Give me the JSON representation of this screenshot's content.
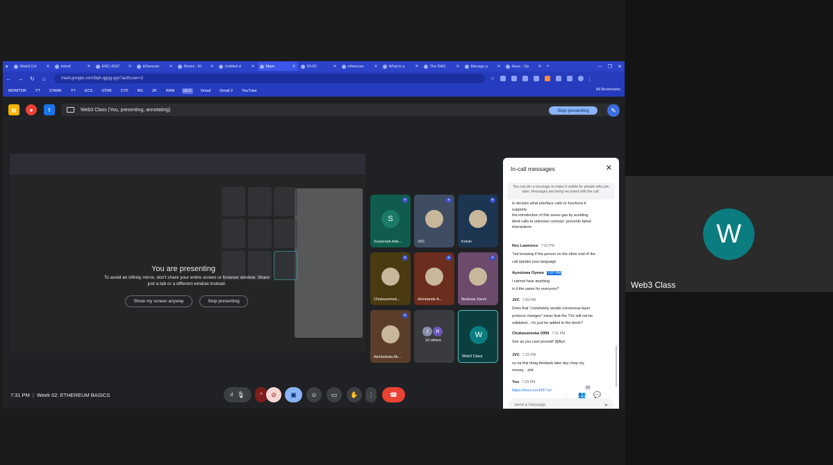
{
  "right_panel": {
    "avatar_letter": "W",
    "name": "Web3 Class",
    "avatar_color": "#0b7d80"
  },
  "tabs": [
    {
      "label": "Web3 Col"
    },
    {
      "label": "Introd"
    },
    {
      "label": "ERC-4337"
    },
    {
      "label": "Ethereum"
    },
    {
      "label": "Remix - Et"
    },
    {
      "label": "Untitled d"
    },
    {
      "label": "Meet",
      "active": true
    },
    {
      "label": "00:00:"
    },
    {
      "label": "ethereum"
    },
    {
      "label": "What is a"
    },
    {
      "label": "The DAO"
    },
    {
      "label": "Manage p"
    },
    {
      "label": "Aave - Op"
    }
  ],
  "address": {
    "url": "meet.google.com/bqh-qgqg-ygv?authuser=2"
  },
  "bookmarks": [
    "MONITOR",
    "YT",
    "STARK",
    "YT",
    "ECS",
    "STRK",
    "CYF",
    "BG",
    "ZK",
    "RAM",
    "GLO",
    "Gmail",
    "Gmail 2",
    "YouTube"
  ],
  "all_bookmarks": "All Bookmarks",
  "presentation_bar": {
    "label": "Web3 Class (You, presenting, annotating)",
    "stop_label": "Stop presenting"
  },
  "mirror": {
    "title": "You are presenting",
    "text": "To avoid an infinity mirror, don't share your entire screen or browser window. Share just a tab or a different window instead.",
    "show_anyway": "Show my screen anyway",
    "stop": "Stop presenting"
  },
  "participants": [
    {
      "name": "Susannah Ade...",
      "letter": "S",
      "color": "#0f5c4e"
    },
    {
      "name": "JVC",
      "letter": "",
      "color": "#3f4d63"
    },
    {
      "name": "Kelvin",
      "letter": "",
      "color": "#1c3550"
    },
    {
      "name": "Chukwuemek...",
      "letter": "",
      "color": "#4a3a10"
    },
    {
      "name": "Akinbande A...",
      "letter": "",
      "color": "#6b2d1e"
    },
    {
      "name": "Ifeoluwa Sanni",
      "letter": "",
      "color": "#6b4a6b"
    },
    {
      "name": "Akinbobola Ak...",
      "letter": "",
      "color": "#5a3e2b"
    },
    {
      "name": "10 others",
      "letter": "",
      "color": "#3a3b3f"
    },
    {
      "name": "Web3 Class",
      "letter": "W",
      "color": "#0b3f3f"
    }
  ],
  "others": {
    "j": "J",
    "r": "R"
  },
  "chat": {
    "title": "In-call messages",
    "note": "You can pin a message to make it visible for people who join later. Messages are being recorded with the call.",
    "first_lines": [
      "to declare what interface calls or functions it",
      "supports",
      "the introduction of this saves gas by avoiding",
      "blind calls to unknown contract ,prevents failed",
      "interactions"
    ],
    "messages": [
      {
        "sender": "Rex Lawrence",
        "time": "7:01 PM",
        "lines": [
          "\"not knowing if the person on the other end of the",
          "call speaks your language"
        ]
      },
      {
        "sender": "Ayooluwa Oyewo",
        "time": "7:07 PM",
        "highlight": true,
        "lines": [
          "i cannot hear anything",
          "is it the same for everyone?"
        ]
      },
      {
        "sender": "JVC",
        "time": "7:09 PM",
        "lines": [
          "Does that \"completely avoids consensus-layer",
          "protocol changes\" mean that the TXs will not be",
          "validated... it's just be added to the block?"
        ]
      },
      {
        "sender": "Chukwuemeka Offili",
        "time": "7:11 PM",
        "lines": [
          "See as you cast yourself @Ayo"
        ]
      },
      {
        "sender": "JVC",
        "time": "7:22 PM",
        "lines": [
          "so na this thing thirdweb take dey chop my",
          "money... shit"
        ]
      },
      {
        "sender": "You",
        "time": "7:29 PM",
        "link": true,
        "lines": [
          "https://docs.erc4337.io/"
        ]
      }
    ],
    "input_placeholder": "Send a message"
  },
  "bottom": {
    "time": "7:31 PM",
    "separator": "|",
    "meeting": "Week 02: ETHEREUM BASICS",
    "people_count": "19"
  },
  "colors": {
    "tab_bar": "#2b43c9",
    "end_call": "#ea4335",
    "accent": "#8ab4f8"
  }
}
